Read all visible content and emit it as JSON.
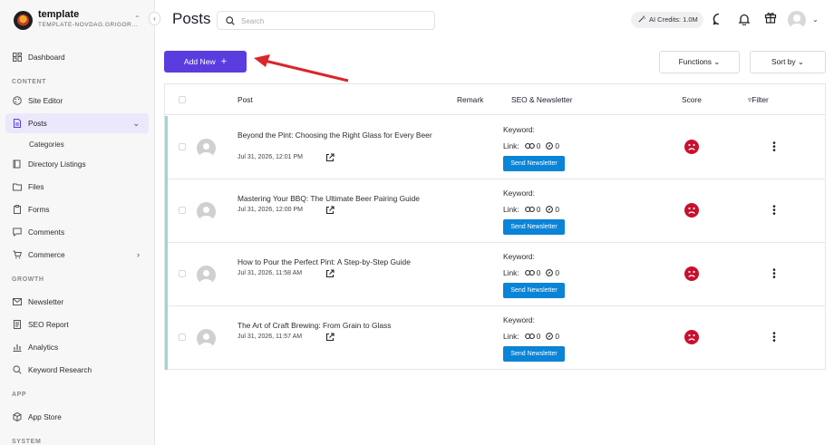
{
  "sidebar": {
    "site_name": "template",
    "site_subtitle": "TEMPLATE-NOVDAG.GRIGOR...",
    "collapse_glyph": "‹",
    "sections": {
      "content": "CONTENT",
      "growth": "GROWTH",
      "app": "APP",
      "system": "SYSTEM"
    },
    "items": {
      "dashboard": "Dashboard",
      "site_editor": "Site Editor",
      "posts": "Posts",
      "categories": "Categories",
      "directory": "Directory Listings",
      "files": "Files",
      "forms": "Forms",
      "comments": "Comments",
      "commerce": "Commerce",
      "newsletter": "Newsletter",
      "seo_report": "SEO Report",
      "analytics": "Analytics",
      "keyword_research": "Keyword Research",
      "app_store": "App Store"
    }
  },
  "header": {
    "title": "Posts",
    "search_placeholder": "Search",
    "ai_credits": "AI Credits: 1.0M"
  },
  "toolbar": {
    "add_new": "Add New",
    "add_plus": "+",
    "functions": "Functions",
    "sort_by": "Sort by"
  },
  "table": {
    "headers": {
      "post": "Post",
      "remark": "Remark",
      "seo": "SEO & Newsletter",
      "score": "Score",
      "filter": "Filter"
    },
    "keyword_label": "Keyword:",
    "link_label": "Link:",
    "newsletter_button": "Send Newsletter",
    "rows": [
      {
        "title": "Beyond the Pint: Choosing the Right Glass for Every Beer",
        "date": "Jul 31, 2026, 12:01 PM",
        "links": "0",
        "external": "0"
      },
      {
        "title": "Mastering Your BBQ: The Ultimate Beer Pairing Guide",
        "date": "Jul 31, 2026, 12:00 PM",
        "links": "0",
        "external": "0"
      },
      {
        "title": "How to Pour the Perfect Pint: A Step-by-Step Guide",
        "date": "Jul 31, 2026, 11:58 AM",
        "links": "0",
        "external": "0"
      },
      {
        "title": "The Art of Craft Brewing: From Grain to Glass",
        "date": "Jul 31, 2026, 11:57 AM",
        "links": "0",
        "external": "0"
      }
    ]
  },
  "colors": {
    "accent": "#5b3cdf",
    "newsletter": "#0a84d6",
    "score_bad": "#c8102e",
    "row_stripe": "#9ad8d0",
    "annotation_arrow": "#d9262b"
  }
}
